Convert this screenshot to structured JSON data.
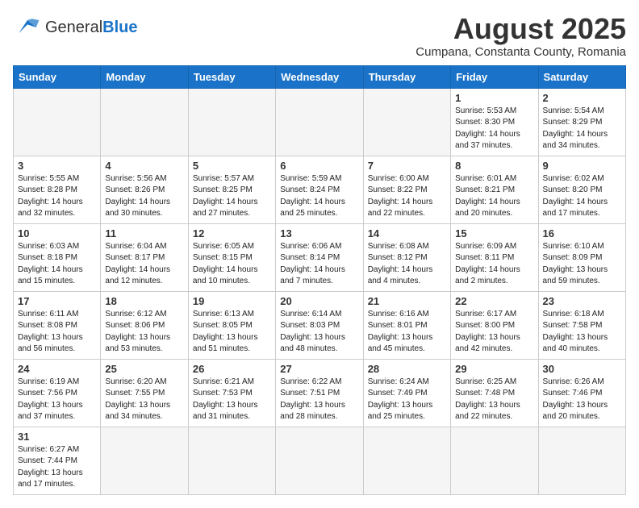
{
  "header": {
    "logo_general": "General",
    "logo_blue": "Blue",
    "month_year": "August 2025",
    "location": "Cumpana, Constanta County, Romania"
  },
  "weekdays": [
    "Sunday",
    "Monday",
    "Tuesday",
    "Wednesday",
    "Thursday",
    "Friday",
    "Saturday"
  ],
  "weeks": [
    [
      {
        "day": "",
        "info": ""
      },
      {
        "day": "",
        "info": ""
      },
      {
        "day": "",
        "info": ""
      },
      {
        "day": "",
        "info": ""
      },
      {
        "day": "",
        "info": ""
      },
      {
        "day": "1",
        "info": "Sunrise: 5:53 AM\nSunset: 8:30 PM\nDaylight: 14 hours and 37 minutes."
      },
      {
        "day": "2",
        "info": "Sunrise: 5:54 AM\nSunset: 8:29 PM\nDaylight: 14 hours and 34 minutes."
      }
    ],
    [
      {
        "day": "3",
        "info": "Sunrise: 5:55 AM\nSunset: 8:28 PM\nDaylight: 14 hours and 32 minutes."
      },
      {
        "day": "4",
        "info": "Sunrise: 5:56 AM\nSunset: 8:26 PM\nDaylight: 14 hours and 30 minutes."
      },
      {
        "day": "5",
        "info": "Sunrise: 5:57 AM\nSunset: 8:25 PM\nDaylight: 14 hours and 27 minutes."
      },
      {
        "day": "6",
        "info": "Sunrise: 5:59 AM\nSunset: 8:24 PM\nDaylight: 14 hours and 25 minutes."
      },
      {
        "day": "7",
        "info": "Sunrise: 6:00 AM\nSunset: 8:22 PM\nDaylight: 14 hours and 22 minutes."
      },
      {
        "day": "8",
        "info": "Sunrise: 6:01 AM\nSunset: 8:21 PM\nDaylight: 14 hours and 20 minutes."
      },
      {
        "day": "9",
        "info": "Sunrise: 6:02 AM\nSunset: 8:20 PM\nDaylight: 14 hours and 17 minutes."
      }
    ],
    [
      {
        "day": "10",
        "info": "Sunrise: 6:03 AM\nSunset: 8:18 PM\nDaylight: 14 hours and 15 minutes."
      },
      {
        "day": "11",
        "info": "Sunrise: 6:04 AM\nSunset: 8:17 PM\nDaylight: 14 hours and 12 minutes."
      },
      {
        "day": "12",
        "info": "Sunrise: 6:05 AM\nSunset: 8:15 PM\nDaylight: 14 hours and 10 minutes."
      },
      {
        "day": "13",
        "info": "Sunrise: 6:06 AM\nSunset: 8:14 PM\nDaylight: 14 hours and 7 minutes."
      },
      {
        "day": "14",
        "info": "Sunrise: 6:08 AM\nSunset: 8:12 PM\nDaylight: 14 hours and 4 minutes."
      },
      {
        "day": "15",
        "info": "Sunrise: 6:09 AM\nSunset: 8:11 PM\nDaylight: 14 hours and 2 minutes."
      },
      {
        "day": "16",
        "info": "Sunrise: 6:10 AM\nSunset: 8:09 PM\nDaylight: 13 hours and 59 minutes."
      }
    ],
    [
      {
        "day": "17",
        "info": "Sunrise: 6:11 AM\nSunset: 8:08 PM\nDaylight: 13 hours and 56 minutes."
      },
      {
        "day": "18",
        "info": "Sunrise: 6:12 AM\nSunset: 8:06 PM\nDaylight: 13 hours and 53 minutes."
      },
      {
        "day": "19",
        "info": "Sunrise: 6:13 AM\nSunset: 8:05 PM\nDaylight: 13 hours and 51 minutes."
      },
      {
        "day": "20",
        "info": "Sunrise: 6:14 AM\nSunset: 8:03 PM\nDaylight: 13 hours and 48 minutes."
      },
      {
        "day": "21",
        "info": "Sunrise: 6:16 AM\nSunset: 8:01 PM\nDaylight: 13 hours and 45 minutes."
      },
      {
        "day": "22",
        "info": "Sunrise: 6:17 AM\nSunset: 8:00 PM\nDaylight: 13 hours and 42 minutes."
      },
      {
        "day": "23",
        "info": "Sunrise: 6:18 AM\nSunset: 7:58 PM\nDaylight: 13 hours and 40 minutes."
      }
    ],
    [
      {
        "day": "24",
        "info": "Sunrise: 6:19 AM\nSunset: 7:56 PM\nDaylight: 13 hours and 37 minutes."
      },
      {
        "day": "25",
        "info": "Sunrise: 6:20 AM\nSunset: 7:55 PM\nDaylight: 13 hours and 34 minutes."
      },
      {
        "day": "26",
        "info": "Sunrise: 6:21 AM\nSunset: 7:53 PM\nDaylight: 13 hours and 31 minutes."
      },
      {
        "day": "27",
        "info": "Sunrise: 6:22 AM\nSunset: 7:51 PM\nDaylight: 13 hours and 28 minutes."
      },
      {
        "day": "28",
        "info": "Sunrise: 6:24 AM\nSunset: 7:49 PM\nDaylight: 13 hours and 25 minutes."
      },
      {
        "day": "29",
        "info": "Sunrise: 6:25 AM\nSunset: 7:48 PM\nDaylight: 13 hours and 22 minutes."
      },
      {
        "day": "30",
        "info": "Sunrise: 6:26 AM\nSunset: 7:46 PM\nDaylight: 13 hours and 20 minutes."
      }
    ],
    [
      {
        "day": "31",
        "info": "Sunrise: 6:27 AM\nSunset: 7:44 PM\nDaylight: 13 hours and 17 minutes."
      },
      {
        "day": "",
        "info": ""
      },
      {
        "day": "",
        "info": ""
      },
      {
        "day": "",
        "info": ""
      },
      {
        "day": "",
        "info": ""
      },
      {
        "day": "",
        "info": ""
      },
      {
        "day": "",
        "info": ""
      }
    ]
  ]
}
